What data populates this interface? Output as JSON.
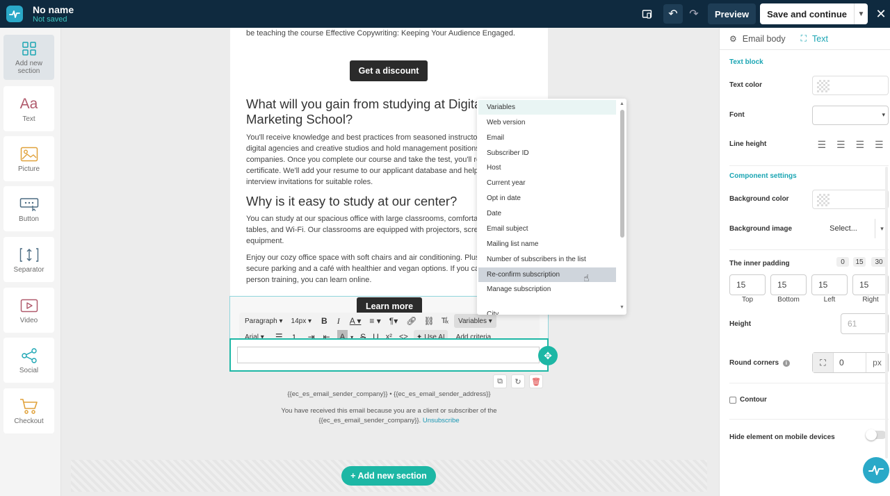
{
  "header": {
    "doc_title": "No name",
    "doc_status": "Not saved",
    "preview_label": "Preview",
    "save_label": "Save and continue"
  },
  "sidebar": {
    "items": [
      {
        "label": "Add new section",
        "icon": "grid-icon"
      },
      {
        "label": "Text",
        "icon": "text-aa-icon"
      },
      {
        "label": "Picture",
        "icon": "picture-icon"
      },
      {
        "label": "Button",
        "icon": "button-icon"
      },
      {
        "label": "Separator",
        "icon": "separator-icon"
      },
      {
        "label": "Video",
        "icon": "video-icon"
      },
      {
        "label": "Social",
        "icon": "share-icon"
      },
      {
        "label": "Checkout",
        "icon": "cart-icon"
      }
    ]
  },
  "email": {
    "intro_line": "be teaching the course Effective Copywriting: Keeping Your Audience Engaged.",
    "discount_btn": "Get a discount",
    "heading1_l1": "What will you gain from studying at Digita",
    "heading1_l2": "Marketing School?",
    "para1_lines": [
      "You'll receive knowledge and best practices from seasoned instructors",
      "digital agencies and creative studios and hold management positions i",
      "companies. Once you complete our course and take the test, you'll rec",
      "certificate. We'll add your resume to our applicant database and help y",
      "interview invitations for suitable roles."
    ],
    "heading2": "Why is it easy to study at our center?",
    "para2_lines": [
      "You can study at our spacious office with large classrooms, comfortabl",
      "tables, and Wi-Fi. Our classrooms are equipped with projectors, screen",
      "equipment."
    ],
    "para3_lines": [
      "Enjoy our cozy office space with soft chairs and air conditioning. Plus,",
      "secure parking and a café with healthier and vegan options. If you can",
      "person training, you can learn online."
    ],
    "learn_more_btn": "Learn more",
    "footer_line1": "{{ec_es_email_sender_company}} • {{ec_es_email_sender_address}}",
    "footer_line2": "You have received this email because you are a client or subscriber of the",
    "footer_line3": "{{ec_es_email_sender_company}}.",
    "unsubscribe": "Unsubscribe"
  },
  "toolbar": {
    "paragraph": "Paragraph",
    "font_size": "14px",
    "variables": "Variables",
    "font_family": "Arial",
    "use_ai": "Use AI",
    "add_criteria": "Add criteria"
  },
  "dropdown": {
    "items": [
      "Variables",
      "Web version",
      "Email",
      "Subscriber ID",
      "Host",
      "Current year",
      "Opt in date",
      "Date",
      "Email subject",
      "Mailing list name",
      "Number of subscribers in the list",
      "Re-confirm subscription",
      "Manage subscription",
      "City"
    ],
    "hover_index": 11
  },
  "add_section_label": "+ Add new section",
  "panel": {
    "tab_email_body": "Email body",
    "tab_text": "Text",
    "text_block": "Text block",
    "text_color": "Text color",
    "font": "Font",
    "line_height": "Line height",
    "component_settings": "Component settings",
    "bg_color": "Background color",
    "bg_image": "Background image",
    "select_label": "Select...",
    "inner_padding": "The inner padding",
    "padding_chips": [
      "0",
      "15",
      "30"
    ],
    "padding_values": [
      "15",
      "15",
      "15",
      "15"
    ],
    "padding_caps": [
      "Top",
      "Bottom",
      "Left",
      "Right"
    ],
    "height": "Height",
    "height_value": "61",
    "round_corners": "Round corners",
    "round_value": "0",
    "round_unit": "px",
    "contour": "Contour",
    "hide_mobile": "Hide element on mobile devices"
  },
  "colors": {
    "topbar": "#0f2a3f",
    "accent": "#1db7a5",
    "link": "#1b97b3"
  }
}
